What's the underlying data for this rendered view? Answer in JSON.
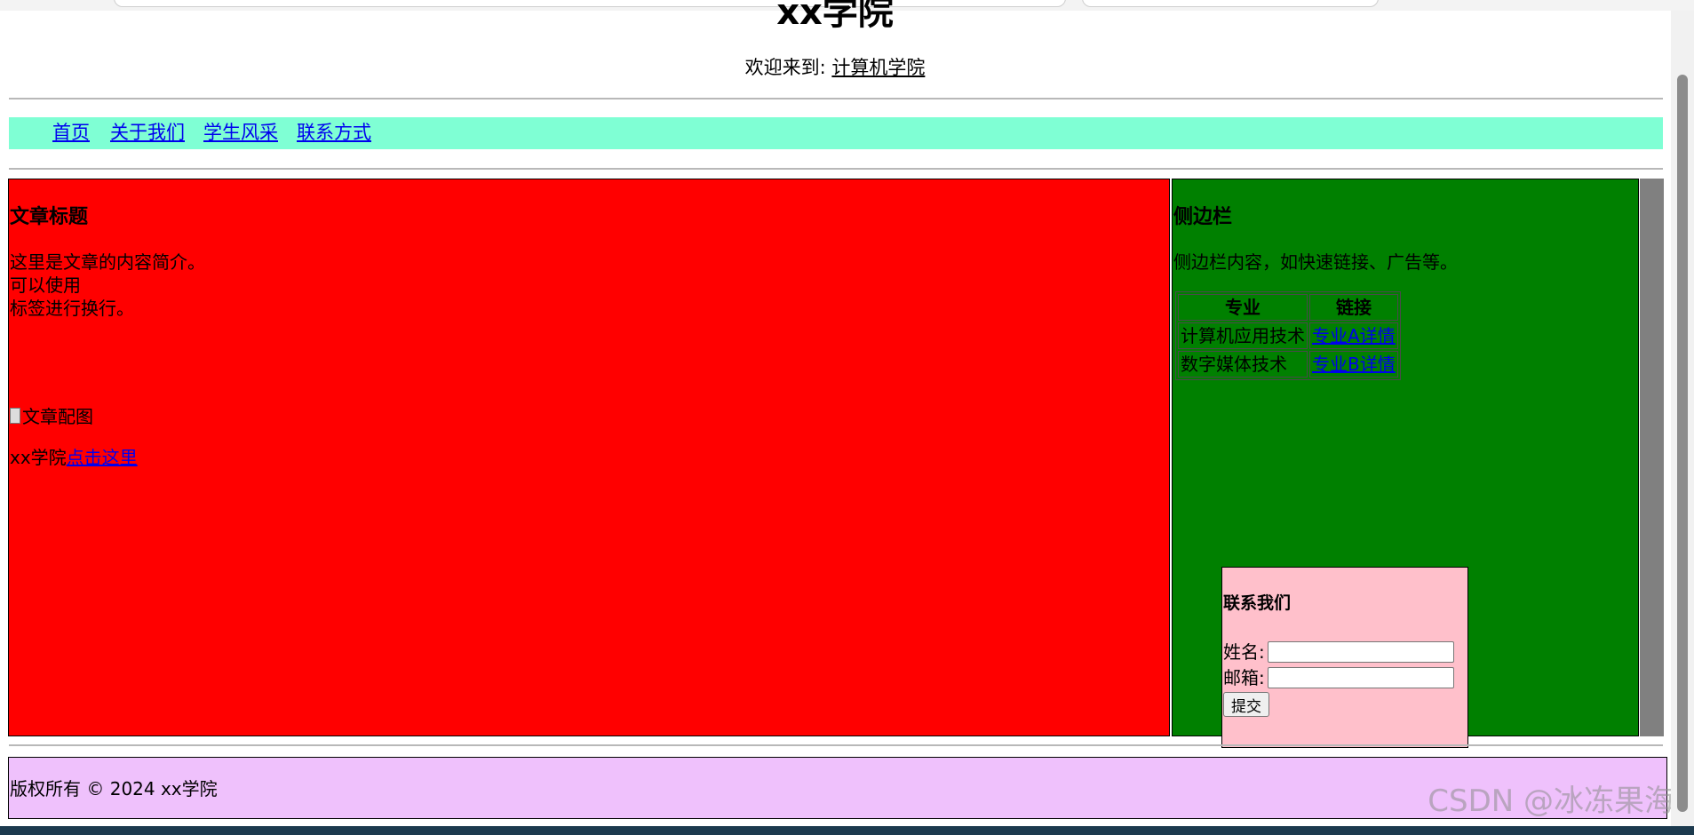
{
  "header": {
    "title": "xx学院",
    "welcome_prefix": "欢迎来到: ",
    "welcome_link": "计算机学院"
  },
  "nav": {
    "items": [
      {
        "label": "首页"
      },
      {
        "label": "关于我们"
      },
      {
        "label": "学生风采"
      },
      {
        "label": "联系方式"
      }
    ]
  },
  "main": {
    "title": "文章标题",
    "lines": [
      "这里是文章的内容简介。",
      "可以使用",
      "标签进行换行。"
    ],
    "image_alt": "文章配图",
    "link_prefix": "xx学院",
    "link_label": "点击这里"
  },
  "sidebar": {
    "title": "侧边栏",
    "text": "侧边栏内容，如快速链接、广告等。",
    "table": {
      "headers": [
        "专业",
        "链接"
      ],
      "rows": [
        {
          "major": "计算机应用技术",
          "link": "专业A详情"
        },
        {
          "major": "数字媒体技术",
          "link": "专业B详情"
        }
      ]
    }
  },
  "contact": {
    "title": "联系我们",
    "name_label": "姓名:",
    "email_label": "邮箱:",
    "submit_label": "提交"
  },
  "footer": {
    "text": "版权所有 © 2024 xx学院"
  },
  "watermark": "CSDN @冰冻果海",
  "colors": {
    "nav_bg": "#7fffd4",
    "main_bg": "#ff0000",
    "sidebar_bg": "#008000",
    "contact_bg": "#ffc0cb",
    "footer_bg": "#efc1fc",
    "link": "#0000ee"
  }
}
